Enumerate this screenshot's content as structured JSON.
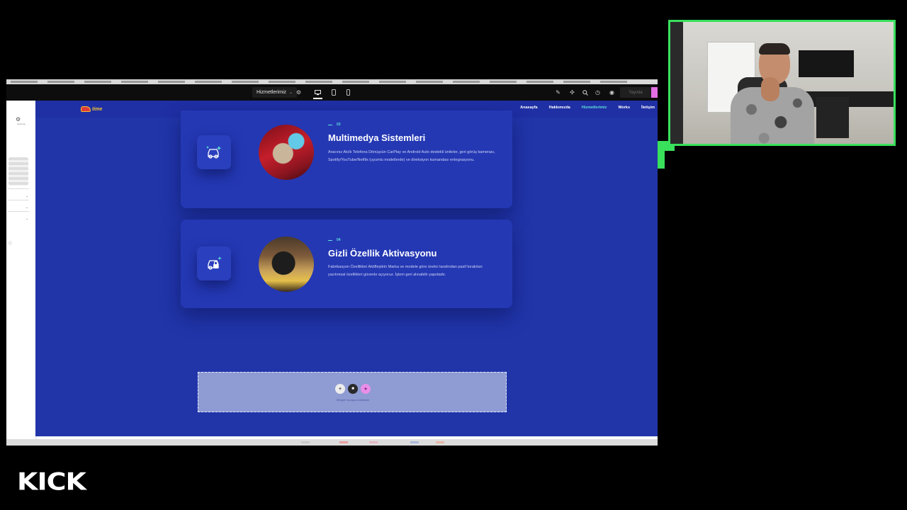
{
  "editor": {
    "page_selector": "Hizmetlerimiz",
    "publish_label": "Yayınla",
    "panel_label": "Gezinme",
    "colors": {
      "topbar": "#0d0d0d",
      "publish_bg": "#1f1f1f",
      "ai_accent": "#e36ee4"
    }
  },
  "site": {
    "logo_text": "time",
    "nav": [
      {
        "label": "Anasayfa"
      },
      {
        "label": "Hakkımızda"
      },
      {
        "label": "Hizmetlerimiz"
      },
      {
        "label": "Works"
      },
      {
        "label": "İletişim"
      }
    ],
    "active_nav": "Hizmetlerimiz",
    "colors": {
      "background": "#2135a9",
      "card": "#2438b4",
      "accent": "#5fe1d9"
    },
    "services": [
      {
        "number": "03",
        "title": "Multimedya Sistemleri",
        "description": "Aracınız Akıllı Telefona Dönüşsün CarPlay ve Android Auto destekli üniteler, geri görüş kamerası, Spotify/YouTube/Netflix (uyumlu modellerde) ve direksiyon kumandası entegrasyonu.",
        "icon": "car-sparkle-icon",
        "image": "car-interior-cleaning-photo"
      },
      {
        "number": "04",
        "title": "Gizli Özellik Aktivasyonu",
        "description": "Fabrikasyon Özellikleri Aktifleştirin Marka ve modele göre üretici tarafından pasif bırakılan yazılımsal özellikleri güvenle açıyoruz. İşlem geri alınabilir yapıdadır.",
        "icon": "car-lock-icon",
        "image": "car-dashboard-photo"
      }
    ],
    "dropzone": {
      "hint": "Widget'ı buraya sürükleyin"
    }
  },
  "stream": {
    "platform_logo": "KICK",
    "overlay_border_color": "#39e05c"
  }
}
